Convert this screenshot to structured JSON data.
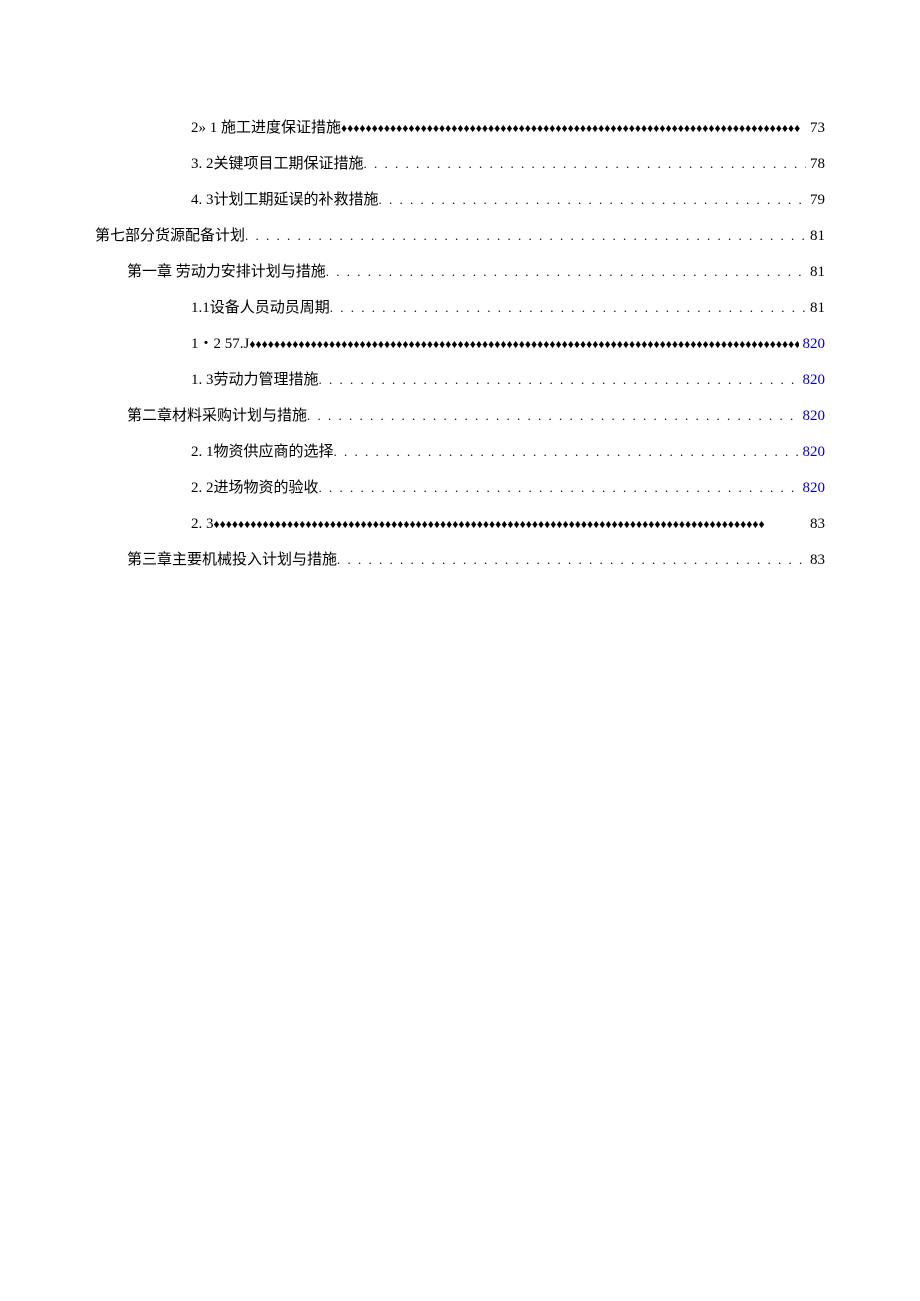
{
  "toc": [
    {
      "indent": 2,
      "label": "2» 1  施工进度保证措施",
      "leader": "diamond",
      "page": "73",
      "pageWide": true,
      "link": false
    },
    {
      "indent": 2,
      "label": "3.    2关键项目工期保证措施",
      "leader": "dots",
      "page": "78",
      "link": false
    },
    {
      "indent": 2,
      "label": "4.    3计划工期延误的补救措施",
      "leader": "dots",
      "page": "79",
      "link": false
    },
    {
      "indent": 0,
      "label": "第七部分货源配备计划",
      "leader": "dots",
      "page": "81",
      "link": false
    },
    {
      "indent": 1,
      "label": "第一章  劳动力安排计划与措施 ",
      "leader": "dots",
      "page": "81",
      "link": false
    },
    {
      "indent": 2,
      "label": "1.1设备人员动员周期",
      "leader": "dots",
      "page": "81",
      "link": false
    },
    {
      "indent": 2,
      "label": "1・2 57.J",
      "leader": "diamond",
      "page": "820",
      "link": true
    },
    {
      "indent": 2,
      "label": "1. 3劳动力管理措施",
      "leader": "dots",
      "page": "820",
      "link": true
    },
    {
      "indent": 1,
      "label": "第二章材料采购计划与措施 ",
      "leader": "dots",
      "page": "820",
      "link": true
    },
    {
      "indent": 2,
      "label": "2. 1物资供应商的选择",
      "leader": "dots",
      "page": "820",
      "link": true
    },
    {
      "indent": 2,
      "label": "2. 2进场物资的验收",
      "leader": "dots",
      "page": "820",
      "link": true
    },
    {
      "indent": 2,
      "label": "2. 3                    ",
      "leader": "diamond",
      "page": "83",
      "link": false
    },
    {
      "indent": 1,
      "label": "第三章主要机械投入计划与措施 ",
      "leader": "dots",
      "page": "83",
      "link": false
    }
  ]
}
